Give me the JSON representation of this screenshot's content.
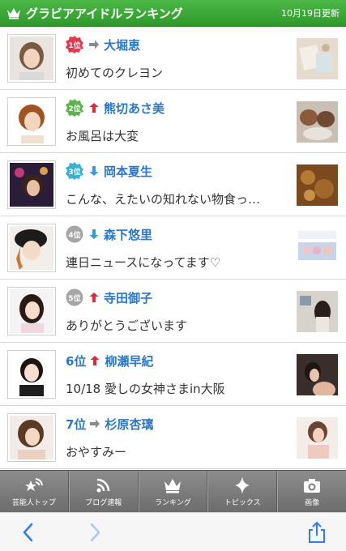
{
  "header": {
    "title": "グラビアアイドルランキング",
    "updated": "10月19日更新"
  },
  "colors": {
    "header_green": "#3aa935",
    "link_blue": "#2a77c9",
    "arrow_up": "#e0283c",
    "arrow_down": "#3a9ad9",
    "arrow_same": "#8a8a8a",
    "rank1_badge": "#e8364e",
    "rank2_badge": "#5bb34a",
    "rank3_badge": "#3ab0d6",
    "rank_other_badge": "#a6a6a6"
  },
  "ranking": [
    {
      "rank": "1位",
      "badge": "red",
      "trend": "same",
      "name": "大堀恵",
      "post": "初めてのクレヨン"
    },
    {
      "rank": "2位",
      "badge": "green",
      "trend": "up",
      "name": "熊切あさ美",
      "post": "お風呂は大変"
    },
    {
      "rank": "3位",
      "badge": "blue",
      "trend": "down",
      "name": "岡本夏生",
      "post": "こんな、えたいの知れない物食っ…"
    },
    {
      "rank": "4位",
      "badge": "gray",
      "trend": "down",
      "name": "森下悠里",
      "post": "連日ニュースになってます♡"
    },
    {
      "rank": "5位",
      "badge": "gray",
      "trend": "up",
      "name": "寺田御子",
      "post": "ありがとうございます"
    },
    {
      "rank": "6位",
      "badge": "none",
      "trend": "up",
      "name": "柳瀬早紀",
      "post": "10/18 愛しの女神さまin大阪"
    },
    {
      "rank": "7位",
      "badge": "none",
      "trend": "same",
      "name": "杉原杏璃",
      "post": "おやすみー"
    }
  ],
  "tabs": [
    {
      "label": "芸能人トップ",
      "icon": "star-wifi-icon"
    },
    {
      "label": "ブログ速報",
      "icon": "rss-icon"
    },
    {
      "label": "ランキング",
      "icon": "crown-icon"
    },
    {
      "label": "トピックス",
      "icon": "sparkle-icon"
    },
    {
      "label": "画像",
      "icon": "camera-icon"
    }
  ],
  "browser": {
    "back_icon": "chevron-left-icon",
    "forward_icon": "chevron-right-icon",
    "share_icon": "share-icon"
  }
}
